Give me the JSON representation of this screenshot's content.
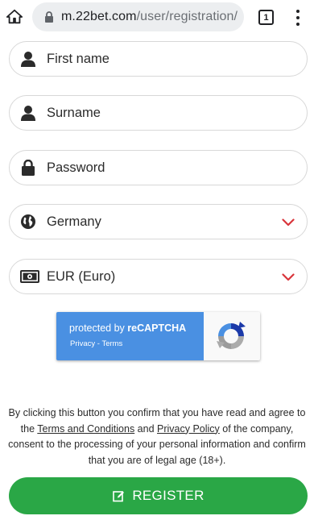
{
  "browser": {
    "url_host": "m.22bet.com",
    "url_path": "/user/registration/",
    "tab_count": "1"
  },
  "form": {
    "first_name": "First name",
    "surname": "Surname",
    "password": "Password",
    "country": "Germany",
    "currency": "EUR (Euro)"
  },
  "recaptcha": {
    "prefix": "protected by ",
    "brand": "reCAPTCHA",
    "privacy": "Privacy",
    "separator": " - ",
    "terms": "Terms"
  },
  "consent": {
    "part1": "By clicking this button you confirm that you have read and agree to the ",
    "terms_link": "Terms and Conditions",
    "and": " and ",
    "privacy_link": "Privacy Policy",
    "part2": " of the company, consent to the processing of your personal information and confirm that you are of legal age (18+)."
  },
  "register_label": "REGISTER",
  "colors": {
    "accent_green": "#2aa746",
    "chevron_red": "#d9353b",
    "recaptcha_blue": "#4a90e2"
  },
  "icons": [
    "home-icon",
    "lock-icon",
    "tab-count-icon",
    "menu-dots-icon",
    "user-icon",
    "padlock-icon",
    "globe-icon",
    "banknote-icon",
    "chevron-down-icon",
    "recaptcha-logo-icon",
    "edit-icon"
  ]
}
